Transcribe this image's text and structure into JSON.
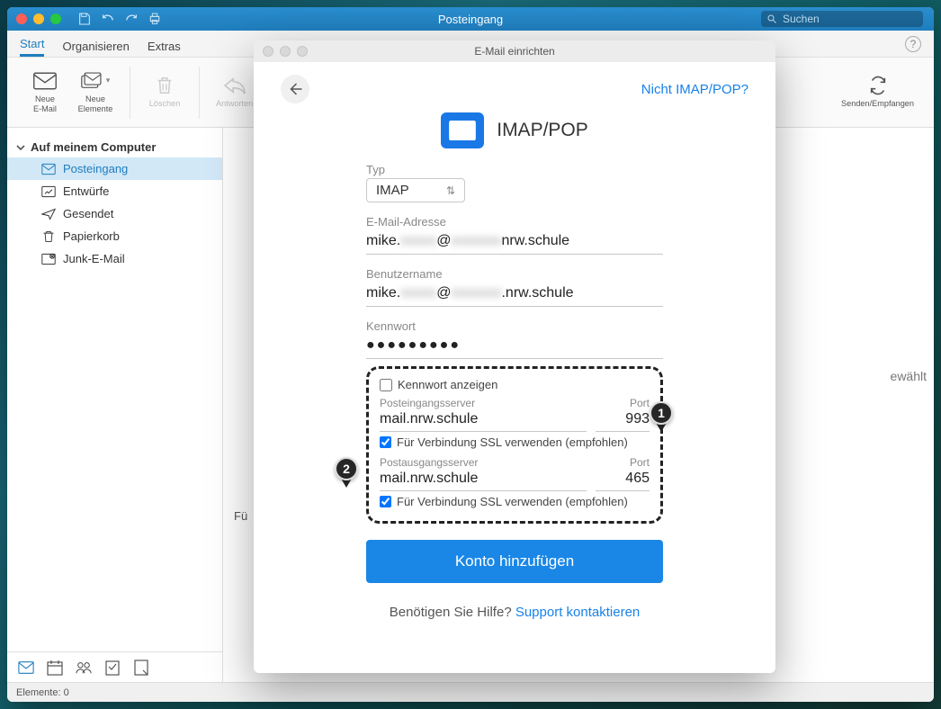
{
  "titlebar": {
    "title": "Posteingang",
    "search_placeholder": "Suchen"
  },
  "ribbon_tabs": {
    "start": "Start",
    "organisieren": "Organisieren",
    "extras": "Extras"
  },
  "ribbon_buttons": {
    "neue_email": "Neue\nE-Mail",
    "neue_elemente": "Neue\nElemente",
    "loeschen": "Löschen",
    "antworten": "Antworten",
    "senden_empfangen": "Senden/Empfangen"
  },
  "sidebar": {
    "header": "Auf meinem Computer",
    "items": [
      {
        "label": "Posteingang"
      },
      {
        "label": "Entwürfe"
      },
      {
        "label": "Gesendet"
      },
      {
        "label": "Papierkorb"
      },
      {
        "label": "Junk-E-Mail"
      }
    ]
  },
  "main_pane": {
    "right_fragment": "ewählt",
    "bottom_left_fragment": "Fü"
  },
  "statusbar": {
    "text": "Elemente: 0"
  },
  "modal": {
    "title": "E-Mail einrichten",
    "not_imap_link": "Nicht IMAP/POP?",
    "heading": "IMAP/POP",
    "type_label": "Typ",
    "type_value": "IMAP",
    "email_label": "E-Mail-Adresse",
    "email_prefix": "mike.",
    "email_mid": "@",
    "email_suffix": "nrw.schule",
    "username_label": "Benutzername",
    "username_prefix": "mike.",
    "username_mid": "@",
    "username_suffix": ".nrw.schule",
    "password_label": "Kennwort",
    "password_dots": "●●●●●●●●●",
    "show_password_label": "Kennwort anzeigen",
    "incoming_label": "Posteingangsserver",
    "port_label": "Port",
    "incoming_server": "mail.nrw.schule",
    "incoming_port": "993",
    "ssl_label": "Für Verbindung SSL verwenden (empfohlen)",
    "outgoing_label": "Postausgangsserver",
    "outgoing_server": "mail.nrw.schule",
    "outgoing_port": "465",
    "primary_button": "Konto hinzufügen",
    "help_text": "Benötigen Sie Hilfe? ",
    "help_link": "Support kontaktieren",
    "pin1": "1",
    "pin2": "2"
  }
}
